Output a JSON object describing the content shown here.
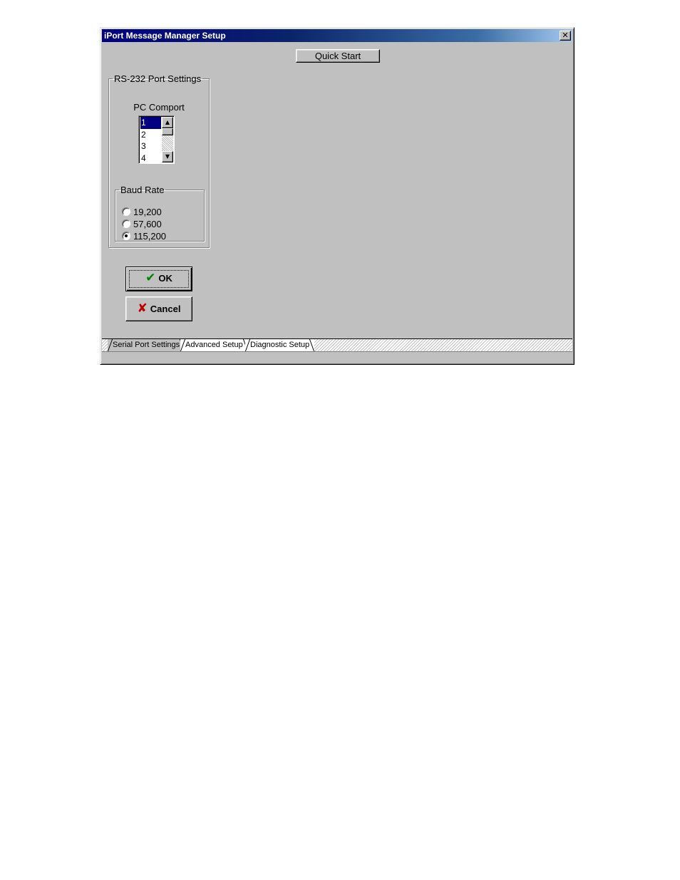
{
  "window": {
    "title": "iPort Message Manager Setup",
    "close_glyph": "✕"
  },
  "toolbar": {
    "quick_start_label": "Quick Start"
  },
  "rs232_group": {
    "legend": "RS-232 Port Settings",
    "pc_comport_label": "PC Comport",
    "comports": [
      "1",
      "2",
      "3",
      "4"
    ],
    "selected_comport": "1",
    "scroll_up_glyph": "▲",
    "scroll_down_glyph": "▼"
  },
  "baud_group": {
    "legend": "Baud Rate",
    "options": [
      {
        "label": "19,200",
        "checked": false
      },
      {
        "label": "57,600",
        "checked": false
      },
      {
        "label": "115,200",
        "checked": true
      }
    ]
  },
  "buttons": {
    "ok_label": "OK",
    "ok_icon": "check-icon",
    "ok_glyph": "✔",
    "cancel_label": "Cancel",
    "cancel_icon": "x-icon",
    "cancel_glyph": "✘"
  },
  "tabs": [
    {
      "label": "Serial Port Settings",
      "active": true
    },
    {
      "label": "Advanced Setup",
      "active": false
    },
    {
      "label": "Diagnostic Setup",
      "active": false
    }
  ],
  "colors": {
    "titlebar_start": "#000080",
    "face": "#c0c0c0",
    "selection": "#000080",
    "ok_check": "#008000",
    "cancel_x": "#c00000"
  }
}
